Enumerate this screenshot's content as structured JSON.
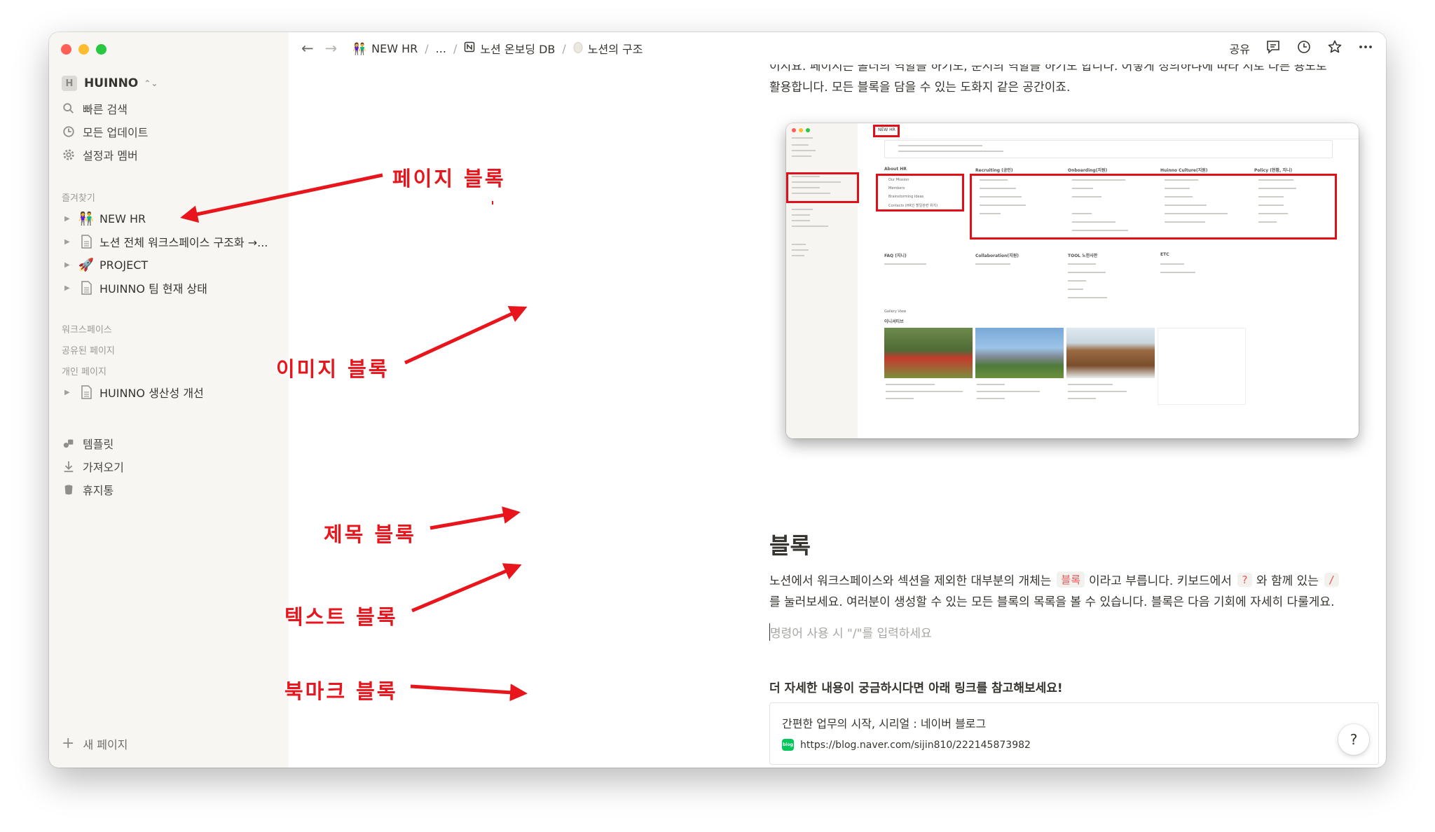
{
  "workspace": {
    "name": "HUINNO",
    "avatar": "H"
  },
  "sidebar": {
    "quick": [
      {
        "label": "빠른 검색",
        "icon": "search-icon"
      },
      {
        "label": "모든 업데이트",
        "icon": "clock-icon"
      },
      {
        "label": "설정과 멤버",
        "icon": "gear-icon"
      }
    ],
    "favorites_title": "즐겨찾기",
    "favorites": [
      {
        "label": "NEW HR",
        "icon": "people-emoji-icon"
      },
      {
        "label": "노션 전체 워크스페이스 구조화 →...",
        "icon": "page-icon"
      },
      {
        "label": "PROJECT",
        "icon": "rocket-icon"
      },
      {
        "label": "HUINNO 팀 현재 상태",
        "icon": "page-icon"
      }
    ],
    "workspace_title": "워크스페이스",
    "shared_title": "공유된 페이지",
    "private_title": "개인 페이지",
    "private": [
      {
        "label": "HUINNO 생산성 개선",
        "icon": "page-icon"
      }
    ],
    "bottom": [
      {
        "label": "템플릿",
        "icon": "shapes-icon"
      },
      {
        "label": "가져오기",
        "icon": "download-icon"
      },
      {
        "label": "휴지통",
        "icon": "trash-icon"
      }
    ],
    "new_page": "새 페이지"
  },
  "topbar": {
    "back": "←",
    "forward": "→",
    "breadcrumbs": [
      {
        "label": "NEW HR",
        "icon": "👫"
      },
      {
        "label": "...",
        "icon": ""
      },
      {
        "label": "노션 온보딩 DB",
        "icon": "notion-icon"
      },
      {
        "label": "노션의 구조",
        "icon": "egg-icon"
      }
    ],
    "share": "공유"
  },
  "content": {
    "cut_line": "이지요. 페이지는 폴더의 역할을 하기도, 문서의 역할을 하기도 합니다. 어떻게 정의하냐에 따라 서로 다른 용도로",
    "line_top": "활용합니다. 모든 블록을 담을 수 있는 도화지 같은 공간이죠.",
    "heading": "블록",
    "para1_a": "노션에서 워크스페이스와 섹션을 제외한 대부분의 개체는",
    "para1_code1": "블록",
    "para1_b": "이라고 부릅니다. 키보드에서",
    "para1_code2": "?",
    "para1_c": "와 함께 있는",
    "para1_code3": "/",
    "para2": "를 눌러보세요. 여러분이 생성할 수 있는 모든 블록의 목록을 볼 수 있습니다. 블록은 다음 기회에 자세히 다룰게요.",
    "placeholder": "명령어 사용 시 \"/\"를 입력하세요",
    "more_info": "더 자세한 내용이 궁금하시다면 아래 링크를 참고해보세요!",
    "bookmark": {
      "title": "간편한 업무의 시작, 시리얼 : 네이버 블로그",
      "url": "https://blog.naver.com/sijin810/222145873982",
      "favicon": "blog"
    },
    "help": "?"
  },
  "screenshot": {
    "title": "NEW HR",
    "sections": [
      "About HR",
      "Recruiting (공인)",
      "Onboarding(지원)",
      "Huinno Culture(지원)",
      "Policy (현황, 지니)",
      "FAQ (지니)",
      "Collaboration(지원)",
      "TOOL 노한사판",
      "ETC",
      "Gallery View",
      "이니셔티브"
    ],
    "about": [
      "Our Mission",
      "Members",
      "Brainstorming Ideas",
      "Contacts (HR인 할일관련 위치)"
    ]
  },
  "annotations": [
    {
      "label": "페이지 블록"
    },
    {
      "label": "이미지 블록"
    },
    {
      "label": "제목 블록"
    },
    {
      "label": "텍스트 블록"
    },
    {
      "label": "북마크 블록"
    }
  ],
  "colors": {
    "annotation": "#e8161c",
    "sidebar_bg": "#f7f6f3",
    "code_red": "#eb5757"
  }
}
